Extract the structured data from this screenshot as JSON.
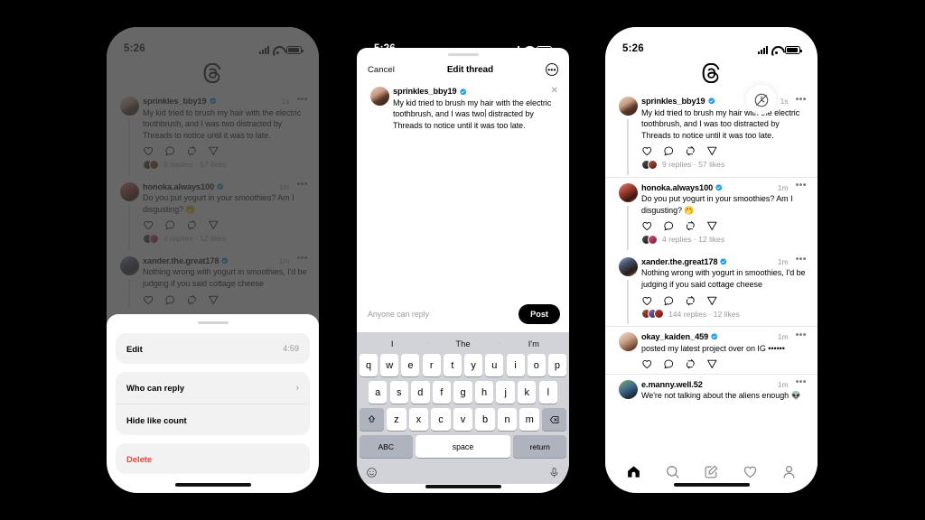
{
  "status_bar": {
    "time": "5:26",
    "signal_icon": "signal-bars-icon",
    "wifi_icon": "wifi-icon",
    "battery_icon": "battery-icon"
  },
  "brand": {
    "logo_icon": "threads-logo-icon"
  },
  "phone1": {
    "label": "threads-feed-dimmed",
    "posts": [
      {
        "username": "sprinkles_bby19",
        "verified": true,
        "time": "1s",
        "text": "My kid tried to brush my hair with the electric toothbrush, and I was two distracted by Threads to notice until it was to late.",
        "stats": "9 replies  ·  57 likes"
      },
      {
        "username": "honoka.always100",
        "verified": true,
        "time": "1m",
        "text": "Do you put yogurt in your smoothies? Am I disgusting? 🤭",
        "stats": "4 replies  ·  12 likes"
      },
      {
        "username": "xander.the.great178",
        "verified": true,
        "time": "1m",
        "text": "Nothing wrong with yogurt in smoothies, I'd be judging if you said cottage cheese",
        "stats": ""
      }
    ],
    "action_sheet": {
      "edit_label": "Edit",
      "edit_timer": "4:59",
      "who_can_reply_label": "Who can reply",
      "hide_like_count_label": "Hide like count",
      "delete_label": "Delete",
      "chevron": "›"
    }
  },
  "phone2": {
    "label": "edit-thread-composer",
    "header": {
      "cancel_label": "Cancel",
      "title": "Edit thread",
      "more_icon": "more-circle-icon"
    },
    "composer": {
      "username": "sprinkles_bby19",
      "verified": true,
      "text_before_caret": "My kid tried to brush my hair with the electric toothbrush, and I was two",
      "text_after_caret": " distracted by Threads to notice until it was too late.",
      "close_icon": "close-icon"
    },
    "footer": {
      "reply_policy": "Anyone can reply",
      "post_label": "Post"
    },
    "keyboard": {
      "predictions": [
        "I",
        "The",
        "I'm"
      ],
      "row1": [
        "q",
        "w",
        "e",
        "r",
        "t",
        "y",
        "u",
        "i",
        "o",
        "p"
      ],
      "row2": [
        "a",
        "s",
        "d",
        "f",
        "g",
        "h",
        "j",
        "k",
        "l"
      ],
      "row3": [
        "z",
        "x",
        "c",
        "v",
        "b",
        "n",
        "m"
      ],
      "shift_icon": "shift-icon",
      "backspace_icon": "backspace-icon",
      "abc_label": "ABC",
      "space_label": "space",
      "return_label": "return",
      "emoji_icon": "emoji-icon",
      "mic_icon": "microphone-icon"
    }
  },
  "phone3": {
    "label": "threads-feed-edited",
    "edit_badge_icon": "edit-timer-icon",
    "posts": [
      {
        "username": "sprinkles_bby19",
        "verified": true,
        "time": "1s",
        "text": "My kid tried to brush my hair with the electric toothbrush, and I was too distracted by Threads to notice until it was too late.",
        "stats": "9 replies  ·  57 likes"
      },
      {
        "username": "honoka.always100",
        "verified": true,
        "time": "1m",
        "text": "Do you put yogurt in your smoothies? Am I disgusting? 🤭",
        "stats": "4 replies  ·  12 likes"
      },
      {
        "username": "xander.the.great178",
        "verified": true,
        "time": "1m",
        "text": "Nothing wrong with yogurt in smoothies, I'd be judging if you said cottage cheese",
        "stats": "144 replies  ·  12 likes"
      },
      {
        "username": "okay_kaiden_459",
        "verified": true,
        "time": "1m",
        "text": "posted my latest project over on IG ••••••",
        "stats": ""
      },
      {
        "username": "e.manny.well.52",
        "verified": false,
        "time": "1m",
        "text": "We're not talking about the aliens enough 👽",
        "stats": ""
      }
    ],
    "nav": [
      {
        "name": "home",
        "icon": "home-icon",
        "active": true
      },
      {
        "name": "search",
        "icon": "search-icon",
        "active": false
      },
      {
        "name": "compose",
        "icon": "compose-icon",
        "active": false
      },
      {
        "name": "activity",
        "icon": "heart-icon",
        "active": false
      },
      {
        "name": "profile",
        "icon": "person-icon",
        "active": false
      }
    ]
  },
  "colors": {
    "background": "#000000",
    "accent": "#1d7bf0",
    "danger": "#ff3b30",
    "dim": "#3c3c3c"
  }
}
